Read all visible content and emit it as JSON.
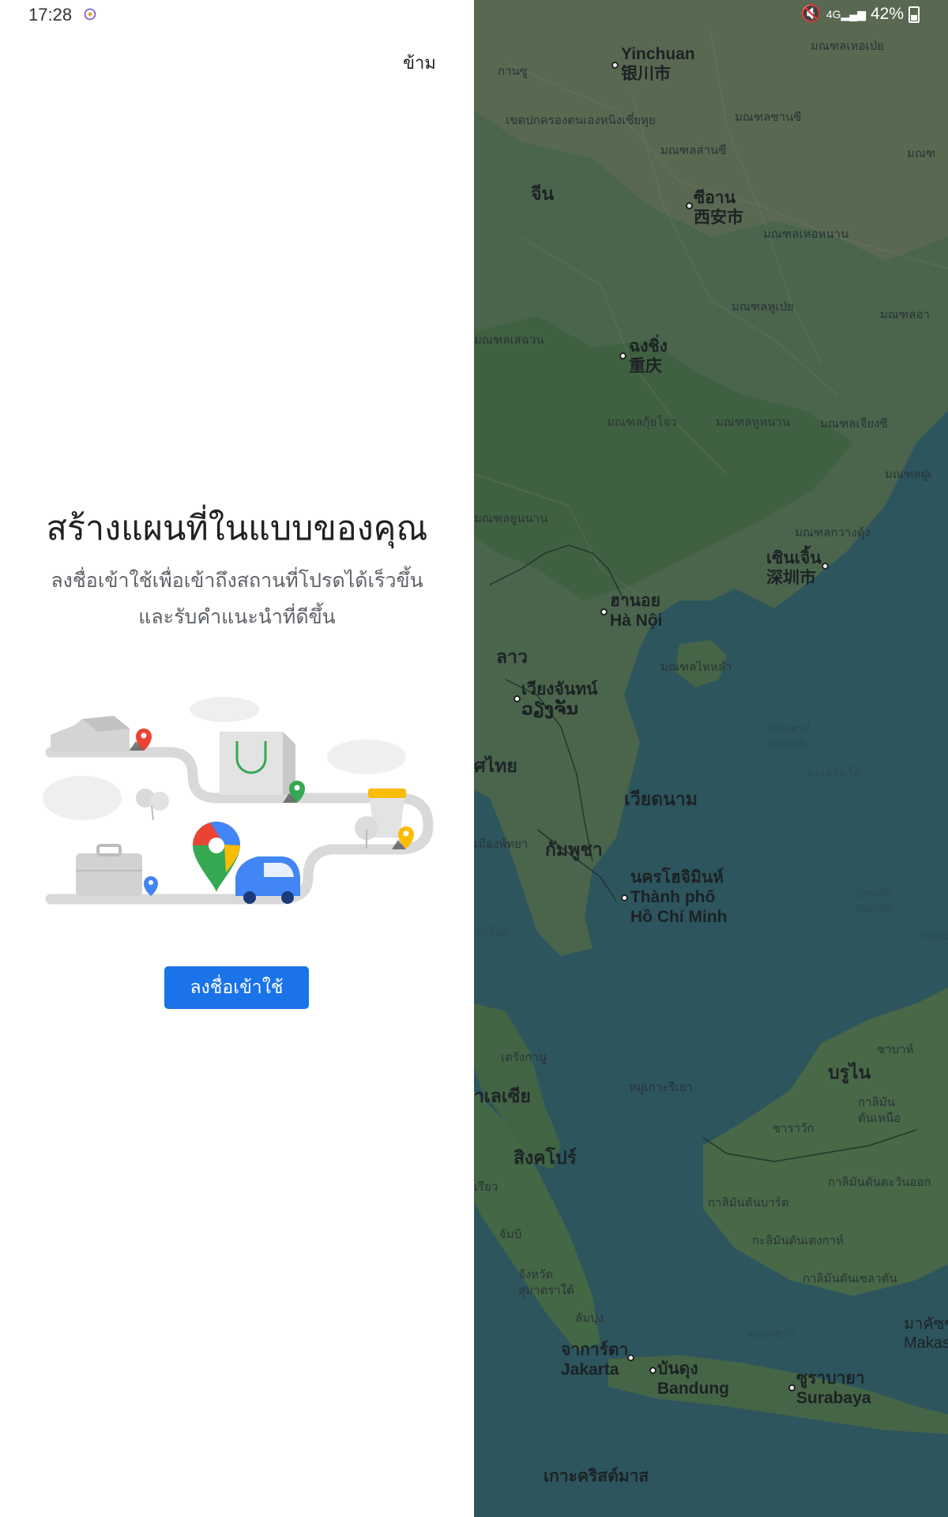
{
  "status_bar": {
    "time": "17:28",
    "app_icon": "globe-icon",
    "right_text": "42%",
    "right_icons": [
      "mute-icon",
      "4g-icon",
      "signal-icon",
      "battery-icon"
    ]
  },
  "panel": {
    "skip_label": "ข้าม",
    "title": "สร้างแผนที่ในแบบของคุณ",
    "subtitle_line1": "ลงชื่อเข้าใช้เพื่อเข้าถึงสถานที่โปรดได้เร็วขึ้น",
    "subtitle_line2": "และรับคำแนะนำที่ดีขึ้น",
    "signin_label": "ลงชื่อเข้าใช้",
    "accent_color": "#1a73e8"
  },
  "map": {
    "labels": {
      "yinchuan": "Yinchuan",
      "yinchuan_cn": "银川市",
      "kansu": "กานซู",
      "ningxia": "เขตปกครองตนเองหนิงเซี่ยหุย",
      "shaanxi_n": "มณฑลซานซี",
      "shaanxi": "มณฑลส่านซี",
      "china": "จีน",
      "xian": "ซีอาน",
      "xian_cn": "西安市",
      "henan": "มณฑลเหอหนาน",
      "hubei": "มณฑลหูเป่ย",
      "sichuan": "มณฑลเสฉวน",
      "chongqing": "ฉงชิ่ง",
      "chongqing_cn": "重庆",
      "guizhou": "มณฑลกุ้ยโจว",
      "hunan": "มณฑลหูหนาน",
      "jiangxi": "มณฑลเจียงซี",
      "yunnan": "มณฑลยูนนาน",
      "guangdong": "มณฑลกวางตุ้ง",
      "shenzhen": "เซินเจิ้น",
      "shenzhen_cn": "深圳市",
      "hanoi_th": "ฮานอย",
      "hanoi": "Hà Nội",
      "hainan": "มณฑลไหหลำ",
      "laos": "ลาว",
      "vientiane": "เวียงจันทน์",
      "vientiane_lo": "ວຽງຈັນ",
      "paracel": "Paracel",
      "paracel2": "Islands",
      "thailand": "ศไทย",
      "vietnam": "เวียดนาม",
      "scs": "ทะเลจีนใต้",
      "pattaya": "เมืองพัทยา",
      "cambodia": "กัมพูชา",
      "hcm_th": "นครโฮจิมินห์",
      "hcm1": "Thành phố",
      "hcm2": "Hồ Chí Minh",
      "spratly": "Spratly",
      "spratly2": "Islands",
      "gulf": "ววไทย",
      "palawan": "Palaw",
      "terengganu": "เตรังกานู",
      "sabah": "ซาบาห์",
      "brunei": "บรูไน",
      "malaysia": "าเลเซีย",
      "riau": "หมู่เกาะรีเยา",
      "kaltara": "กาลิมัน",
      "kaltara2": "ตันเหนือ",
      "sarawak": "ซาราวัก",
      "singapore": "สิงคโปร์",
      "kaltim": "กาลิมันตันตะวันออก",
      "kalbar": "กาลิมันตันบาร์ต",
      "riau2": "เรียว",
      "jambi": "จัมบิ",
      "kalteng": "กะลิมันตันเตงกาห์",
      "sumsel": "จังหวัด",
      "sumsel2": "สุมาตราใต้",
      "kalsel": "กาลิมันตันเซลาตัน",
      "lampung": "ลัมปุง",
      "makassar": "มาคัซซ",
      "makassar2": "Makass",
      "java_sea": "ทะเลชวา",
      "jakarta_th": "จาการ์ตา",
      "jakarta": "Jakarta",
      "bandung_th": "บันดุง",
      "bandung": "Bandung",
      "surabaya_th": "ซูราบายา",
      "surabaya": "Surabaya",
      "christmas": "เกาะคริสต์มาส",
      "yunnan2": "มณฑลเหอเป่ย",
      "guangxi": "มณฑลฝูเ",
      "anhui": "มณฑลอา",
      "shandong": "มณฑ"
    }
  }
}
